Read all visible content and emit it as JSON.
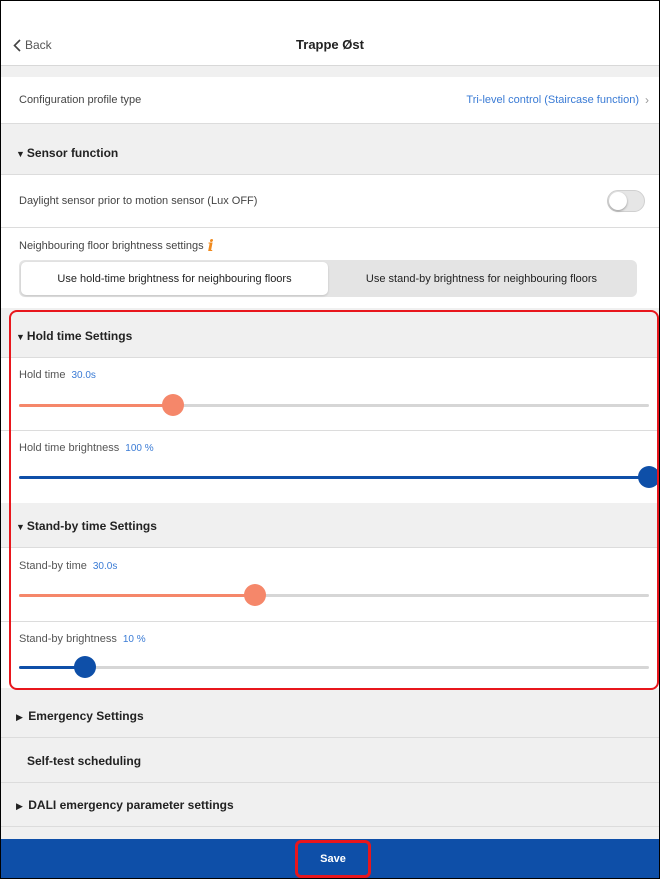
{
  "nav": {
    "back_label": "Back",
    "title": "Trappe Øst"
  },
  "config": {
    "label": "Configuration profile type",
    "value": "Tri-level control (Staircase function)"
  },
  "sensor": {
    "title": "Sensor function",
    "daylight_label": "Daylight sensor prior to motion sensor (Lux OFF)",
    "daylight_enabled": false,
    "neighbour_label": "Neighbouring floor brightness settings",
    "segments": [
      "Use hold-time brightness for neighbouring floors",
      "Use stand-by brightness for neighbouring floors"
    ],
    "selected_segment": 0
  },
  "hold": {
    "title": "Hold time Settings",
    "time_label": "Hold time",
    "time_value": "30.0s",
    "time_fraction": 0.245,
    "brightness_label": "Hold time brightness",
    "brightness_value": "100 %",
    "brightness_fraction": 1.0
  },
  "standby": {
    "title": "Stand-by time Settings",
    "time_label": "Stand-by time",
    "time_value": "30.0s",
    "time_fraction": 0.375,
    "brightness_label": "Stand-by brightness",
    "brightness_value": "10 %",
    "brightness_fraction": 0.105
  },
  "sections": {
    "emergency": "Emergency Settings",
    "selftest": "Self-test scheduling",
    "dali": "DALI emergency parameter settings"
  },
  "footer": {
    "save_label": "Save"
  },
  "colors": {
    "accent_blue": "#3a7bd5",
    "orange_slider": "#f5876a",
    "blue_slider": "#0e4fa8",
    "footer_bg": "#0e4fa8",
    "highlight_red": "#e8161c"
  },
  "icons": {
    "back": "chevron-left-icon",
    "config_chevron": "chevron-right-icon",
    "info": "info-icon",
    "section_expanded": "triangle-down-icon",
    "section_collapsed": "triangle-right-icon"
  }
}
